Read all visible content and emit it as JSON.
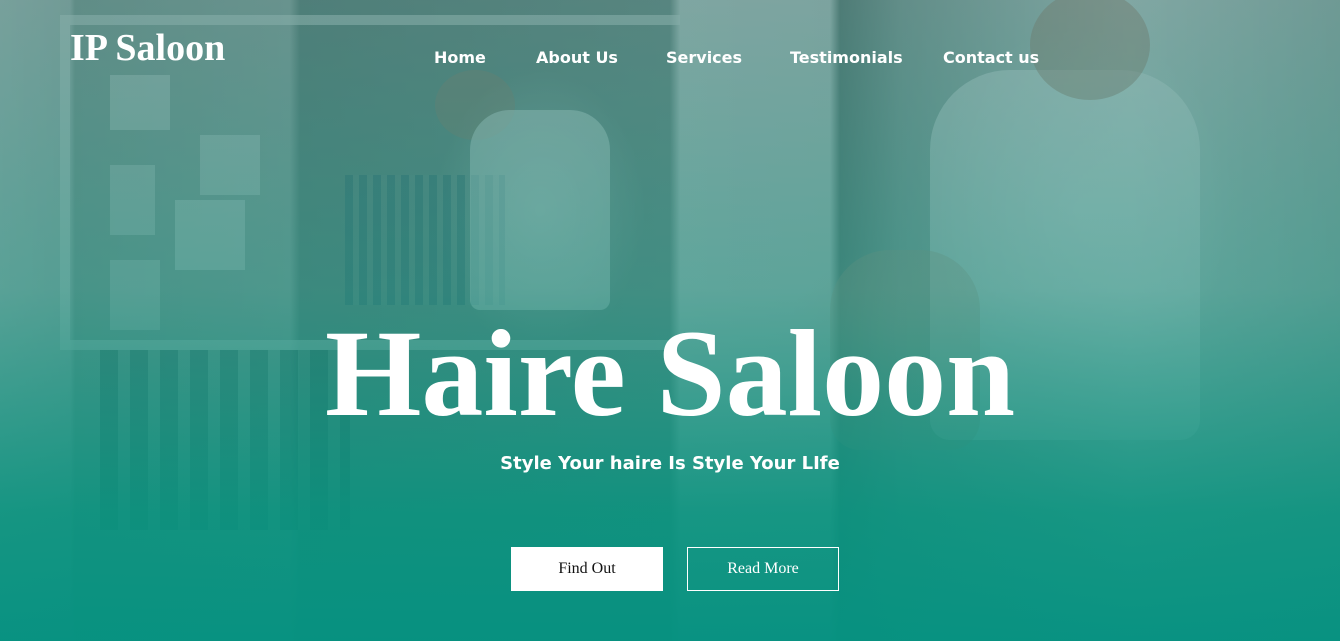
{
  "brand": {
    "logo_text": "IP Saloon"
  },
  "nav": {
    "items": [
      {
        "label": "Home"
      },
      {
        "label": "About Us"
      },
      {
        "label": "Services"
      },
      {
        "label": "Testimonials"
      },
      {
        "label": "Contact us"
      }
    ]
  },
  "hero": {
    "title": "Haire Saloon",
    "tagline": "Style Your haire Is Style Your LIfe",
    "primary_button": "Find Out",
    "secondary_button": "Read More",
    "background_image": "salon-hairdressers-photo",
    "overlay_color": "#05917f"
  }
}
